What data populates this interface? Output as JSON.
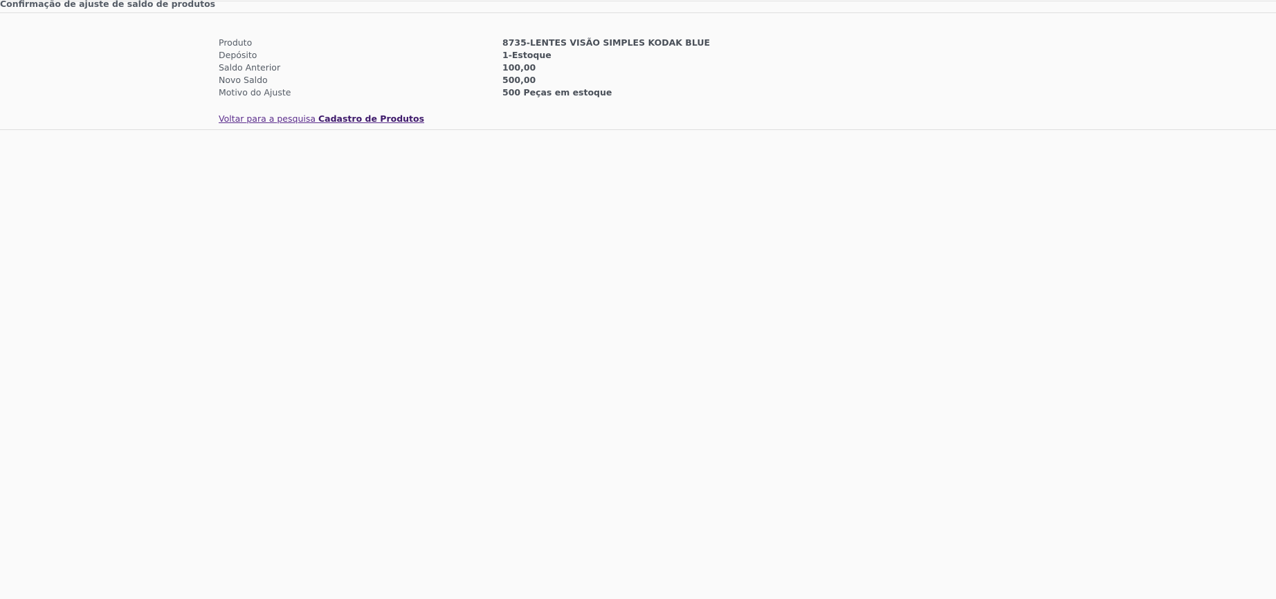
{
  "page": {
    "title": "Confirmação de ajuste de saldo de produtos"
  },
  "details": [
    {
      "label": "Produto",
      "value": "8735-LENTES VISÃO SIMPLES KODAK BLUE"
    },
    {
      "label": "Depósito",
      "value": "1-Estoque"
    },
    {
      "label": "Saldo Anterior",
      "value": "100,00"
    },
    {
      "label": "Novo Saldo",
      "value": "500,00"
    },
    {
      "label": "Motivo do Ajuste",
      "value": "500 Peças em estoque"
    }
  ],
  "back_link": {
    "prefix": "Voltar para a pesquisa",
    "target": "Cadastro de Produtos"
  }
}
